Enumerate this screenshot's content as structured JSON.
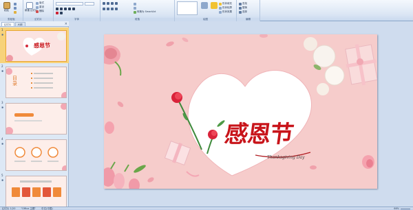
{
  "ribbon": {
    "groups": [
      {
        "label": "剪贴板",
        "big": "粘贴",
        "smalls": []
      },
      {
        "label": "幻灯片",
        "big": "新建\n幻灯片",
        "smalls": [
          "版式",
          "重设",
          "删除"
        ]
      },
      {
        "label": "字体",
        "big": "",
        "smalls": []
      },
      {
        "label": "段落",
        "big": "",
        "smalls": [
          "",
          "",
          "转换为 SmartArt"
        ]
      },
      {
        "label": "绘图",
        "big": "",
        "smalls": [
          "形状填充",
          "形状轮廓",
          "形状效果"
        ]
      },
      {
        "label": "编辑",
        "big": "",
        "smalls": [
          "查找",
          "替换",
          "选择"
        ]
      }
    ]
  },
  "panel": {
    "tabs": [
      "幻灯片",
      "大纲"
    ],
    "close_glyph": "×",
    "slides": [
      {
        "num": "1",
        "mini_title": "感恩节"
      },
      {
        "num": "2",
        "mini_title": "目录"
      },
      {
        "num": "3",
        "mini_title": ""
      },
      {
        "num": "4",
        "mini_title": ""
      },
      {
        "num": "5",
        "mini_title": ""
      }
    ]
  },
  "slide": {
    "title": "感恩节",
    "subtitle": "Thanksgiving Day"
  },
  "status": {
    "slide_info": "幻灯片 1/20",
    "theme": "\"Office 主题\"",
    "language": "中文(中国)",
    "zoom": "66%"
  },
  "colors": {
    "slide_bg": "#f6cccb",
    "title_red": "#c8141a",
    "ribbon_bg": "#dbe6f4",
    "selected_thumb": "#f7d27a"
  }
}
